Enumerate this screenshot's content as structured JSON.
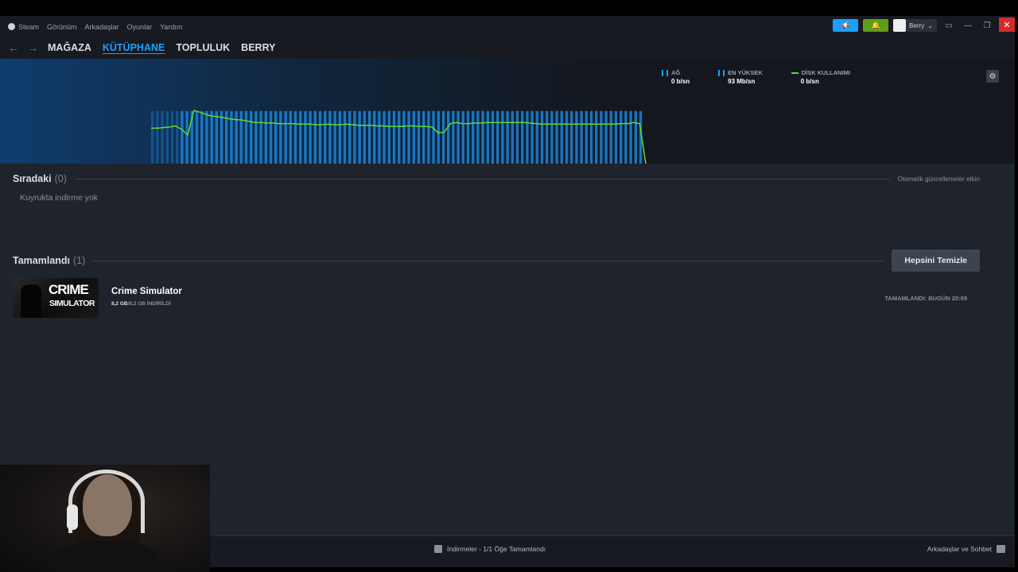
{
  "menu": {
    "items": [
      "Steam",
      "Görünüm",
      "Arkadaşlar",
      "Oyunlar",
      "Yardım"
    ]
  },
  "user": {
    "name": "Berry"
  },
  "nav": {
    "links": [
      "MAĞAZA",
      "KÜTÜPHANE",
      "TOPLULUK",
      "BERRY"
    ],
    "active_index": 1
  },
  "stats": {
    "network": {
      "label": "AĞ",
      "value": "0 b/sn"
    },
    "peak": {
      "label": "EN YÜKSEK",
      "value": "93 Mb/sn"
    },
    "disk": {
      "label": "DİSK KULLANIMI",
      "value": "0 b/sn"
    }
  },
  "chart_data": {
    "type": "bar",
    "series": [
      {
        "values": [
          0.92,
          0.92,
          0.92,
          0.92,
          0.92,
          0.92,
          0.92,
          0.92,
          0.92,
          0.92,
          0.92,
          0.92,
          0.92,
          0.92,
          0.92,
          0.92,
          0.92,
          0.92,
          0.92,
          0.92,
          0.92,
          0.92,
          0.92,
          0.92,
          0.92,
          0.92,
          0.92,
          0.92,
          0.92,
          0.92,
          0.92,
          0.92,
          0.92,
          0.92,
          0.92,
          0.92,
          0.92,
          0.92,
          0.92,
          0.92,
          0.92,
          0.92,
          0.92,
          0.92,
          0.92,
          0.92,
          0.92,
          0.92,
          0.92,
          0.92,
          0.92,
          0.92,
          0.92,
          0.92,
          0.92,
          0.92,
          0.92,
          0.92,
          0.92,
          0.92,
          0.92,
          0.92,
          0.92,
          0.92,
          0.92,
          0.92,
          0.92,
          0.92,
          0.92,
          0.92,
          0.92,
          0.92,
          0.92,
          0.92,
          0.92,
          0.92,
          0.92,
          0.92,
          0.92,
          0.92,
          0.92,
          0.92,
          0.92,
          0.92,
          0.92,
          0.92,
          0.92,
          0.92,
          0.92,
          0.92,
          0.92,
          0.92,
          0.92,
          0.92,
          0.92,
          0.92,
          0.92,
          0.92,
          0.92,
          0.92
        ]
      },
      {
        "values": [
          0.62,
          0.62,
          0.63,
          0.64,
          0.66,
          0.6,
          0.5,
          0.93,
          0.9,
          0.86,
          0.83,
          0.82,
          0.8,
          0.78,
          0.77,
          0.76,
          0.74,
          0.72,
          0.72,
          0.71,
          0.71,
          0.7,
          0.7,
          0.7,
          0.69,
          0.69,
          0.69,
          0.68,
          0.68,
          0.69,
          0.68,
          0.68,
          0.69,
          0.68,
          0.67,
          0.67,
          0.67,
          0.66,
          0.66,
          0.65,
          0.65,
          0.65,
          0.66,
          0.66,
          0.65,
          0.65,
          0.64,
          0.54,
          0.55,
          0.7,
          0.72,
          0.7,
          0.7,
          0.71,
          0.71,
          0.72,
          0.72,
          0.72,
          0.72,
          0.72,
          0.72,
          0.72,
          0.71,
          0.7,
          0.69,
          0.69,
          0.69,
          0.69,
          0.69,
          0.69,
          0.69,
          0.69,
          0.69,
          0.69,
          0.69,
          0.69,
          0.69,
          0.7,
          0.7,
          0.72,
          0.7,
          0.0
        ]
      }
    ]
  },
  "queue": {
    "title": "Sıradaki",
    "count": "(0)",
    "auto_updates": "Otomatik güncellemeler etkin",
    "empty": "Kuyrukta indirme yok"
  },
  "completed": {
    "title": "Tamamlandı",
    "count": "(1)",
    "clear_label": "Hepsini Temizle",
    "items": [
      {
        "title": "Crime Simulator",
        "size_done": "8,2 GB",
        "size_rest": "/8,2 GB İNDİRİLDİ",
        "thumb_line1": "CRIME",
        "thumb_line2": "SIMULATOR",
        "status": "TAMAMLANDI: BUGÜN 20:09"
      }
    ]
  },
  "footer": {
    "downloads": "İndirmeler - 1/1 Öğe Tamamlandı",
    "friends": "Arkadaşlar ve Sohbet"
  },
  "colors": {
    "accent": "#1a9fff",
    "disk_line": "#5edb2f",
    "bars": "#1a7fd0",
    "close": "#d32a2a"
  }
}
